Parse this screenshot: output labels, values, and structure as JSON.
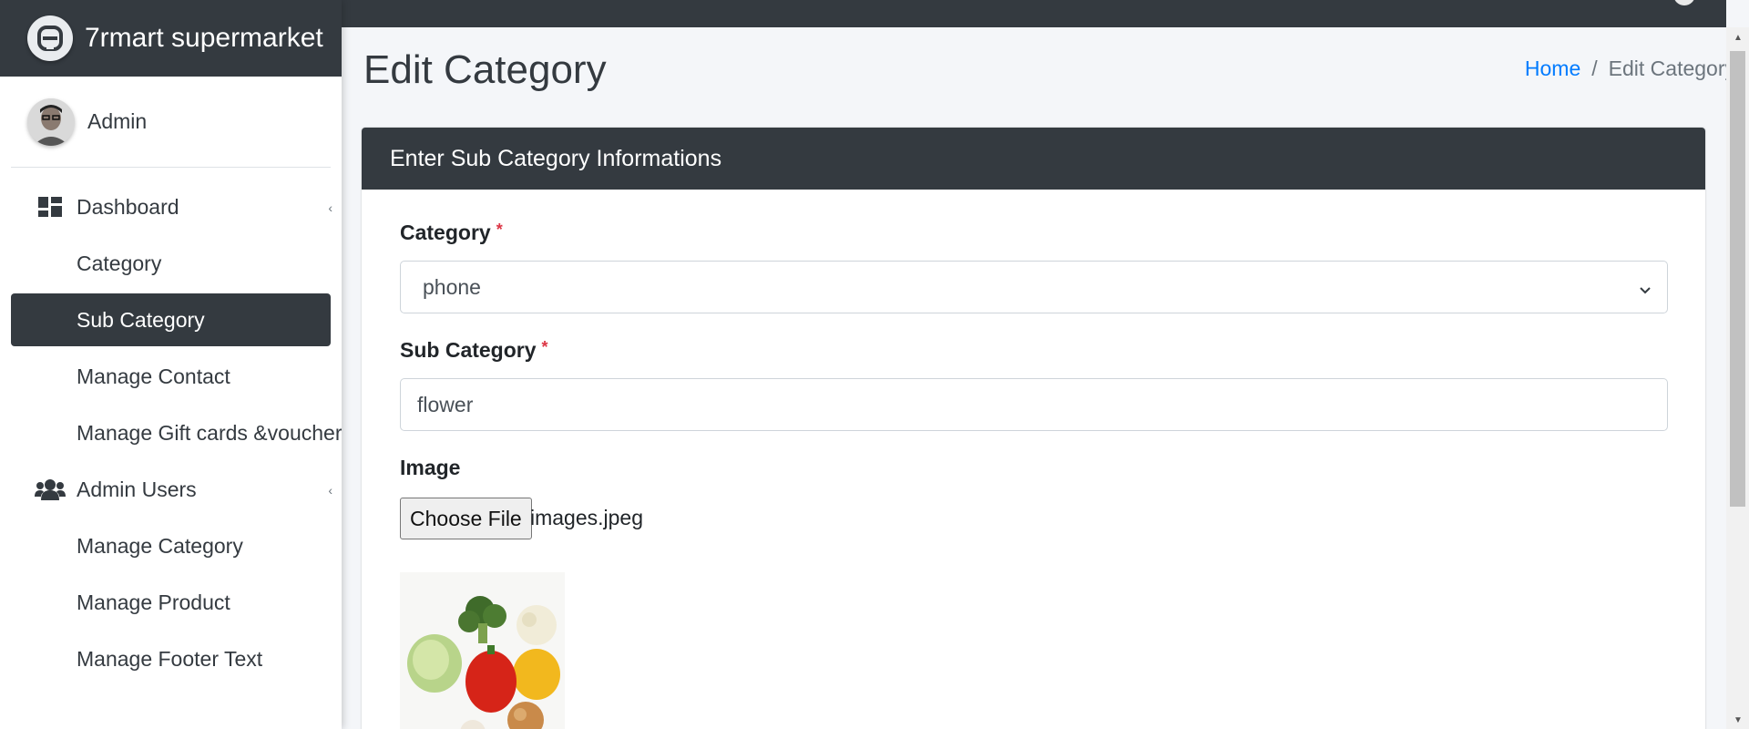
{
  "brand": {
    "name": "7rmart supermarket"
  },
  "user": {
    "name": "Admin"
  },
  "sidebar": {
    "items": [
      {
        "label": "Dashboard",
        "icon": "dashboard-icon"
      },
      {
        "label": "Category"
      },
      {
        "label": "Sub Category"
      },
      {
        "label": "Manage Contact"
      },
      {
        "label": "Manage Gift cards &voucher"
      },
      {
        "label": "Admin Users",
        "icon": "users-icon"
      },
      {
        "label": "Manage Category"
      },
      {
        "label": "Manage Product"
      },
      {
        "label": "Manage Footer Text"
      }
    ]
  },
  "page": {
    "title": "Edit Category",
    "breadcrumb": {
      "home": "Home",
      "separator": "/",
      "current": "Edit Category"
    }
  },
  "form": {
    "header": "Enter Sub Category Informations",
    "category_label": "Category",
    "category_required": "*",
    "category_value": "phone",
    "subcategory_label": "Sub Category",
    "subcategory_required": "*",
    "subcategory_value": "flower",
    "image_label": "Image",
    "file_button": "Choose File",
    "file_name": "images.jpeg"
  },
  "colors": {
    "dark": "#343a40",
    "link": "#007bff",
    "required": "#dc3545",
    "background": "#f4f6f9"
  }
}
